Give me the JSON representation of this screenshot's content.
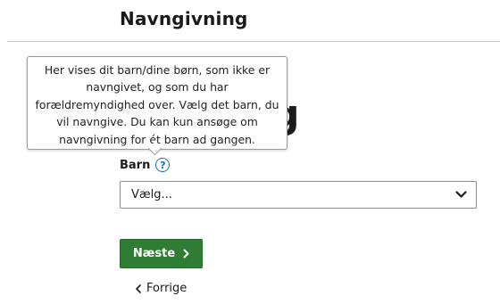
{
  "header": {
    "title": "Navngivning"
  },
  "main": {
    "heading_peek": "g"
  },
  "tooltip": {
    "text": "Her vises dit barn/dine børn, som ikke er navngivet, og som du har forældremyndighed over. Vælg det barn, du vil navngive. Du kan kun ansøge om navngivning for ét barn ad gangen."
  },
  "form": {
    "child_field": {
      "label": "Barn",
      "help_icon": "question-circle-icon",
      "selected_value": "Vælg...",
      "dropdown_icon": "chevron-down-icon"
    }
  },
  "actions": {
    "next_label": "Næste",
    "next_icon": "chevron-right-icon",
    "back_label": "Forrige",
    "back_icon": "chevron-left-icon"
  },
  "colors": {
    "primary_button": "#2e7d32",
    "help_icon": "#1a6fb3",
    "text": "#1b1b1b",
    "divider": "#cfcfcf"
  }
}
